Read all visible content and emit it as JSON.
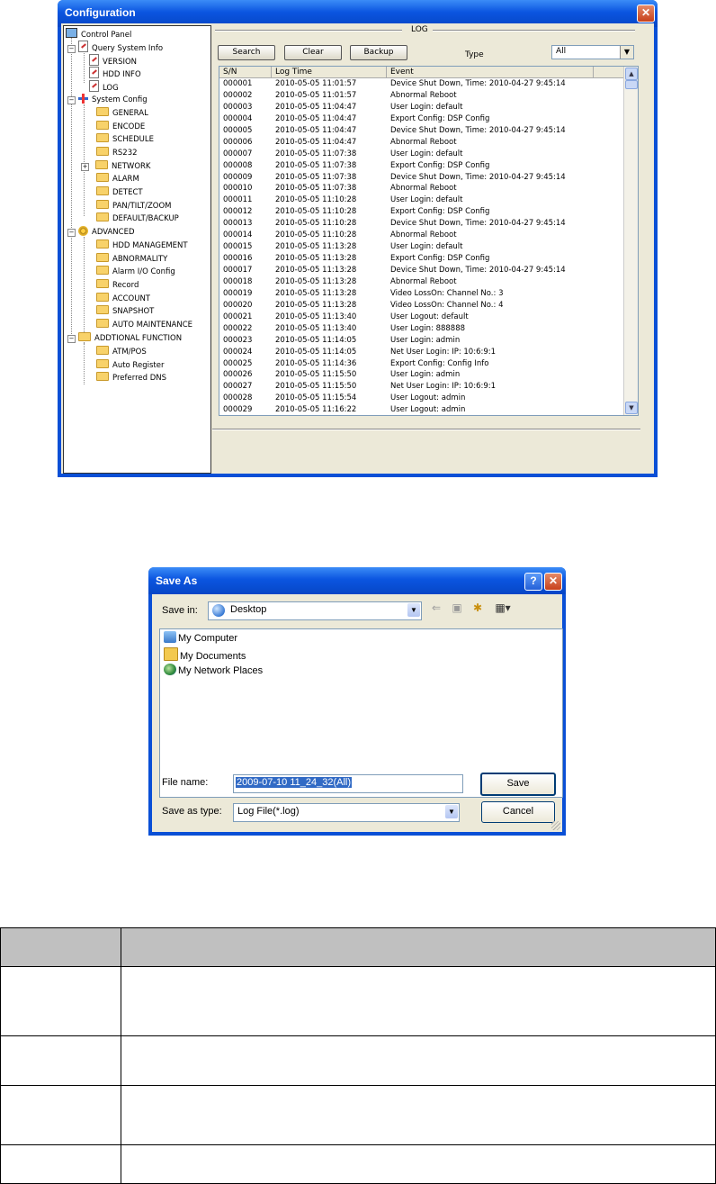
{
  "config_window": {
    "title": "Configuration",
    "close_glyph": "✕",
    "tree": {
      "root": "Control Panel",
      "query_system_info": "Query System Info",
      "version": "VERSION",
      "hdd_info": "HDD INFO",
      "log": "LOG",
      "system_config": "System Config",
      "general": "GENERAL",
      "encode": "ENCODE",
      "schedule": "SCHEDULE",
      "rs232": "RS232",
      "network": "NETWORK",
      "alarm": "ALARM",
      "detect": "DETECT",
      "pan_tilt_zoom": "PAN/TILT/ZOOM",
      "default_backup": "DEFAULT/BACKUP",
      "advanced": "ADVANCED",
      "hdd_management": "HDD MANAGEMENT",
      "abnormality": "ABNORMALITY",
      "alarm_io_config": "Alarm I/O Config",
      "record": "Record",
      "account": "ACCOUNT",
      "snapshot": "SNAPSHOT",
      "auto_maintenance": "AUTO MAINTENANCE",
      "additional_function": "ADDTIONAL FUNCTION",
      "atm_pos": "ATM/POS",
      "auto_register": "Auto Register",
      "preferred_dns": "Preferred DNS",
      "collapse_glyph": "−",
      "expand_glyph": "+"
    },
    "log_panel": {
      "group_title": "LOG",
      "search_label": "Search",
      "clear_label": "Clear",
      "backup_label": "Backup",
      "type_label": "Type",
      "type_value": "All",
      "dropdown_glyph": "▼",
      "columns": {
        "sn": "S/N",
        "time": "Log Time",
        "event": "Event"
      },
      "scroll_up_glyph": "▲",
      "scroll_down_glyph": "▼",
      "rows": [
        {
          "sn": "000001",
          "time": "2010-05-05 11:01:57",
          "event": "Device Shut Down, Time: 2010-04-27 9:45:14"
        },
        {
          "sn": "000002",
          "time": "2010-05-05 11:01:57",
          "event": "Abnormal Reboot"
        },
        {
          "sn": "000003",
          "time": "2010-05-05 11:04:47",
          "event": "User Login: default"
        },
        {
          "sn": "000004",
          "time": "2010-05-05 11:04:47",
          "event": "Export Config: DSP Config"
        },
        {
          "sn": "000005",
          "time": "2010-05-05 11:04:47",
          "event": "Device Shut Down, Time: 2010-04-27 9:45:14"
        },
        {
          "sn": "000006",
          "time": "2010-05-05 11:04:47",
          "event": "Abnormal Reboot"
        },
        {
          "sn": "000007",
          "time": "2010-05-05 11:07:38",
          "event": "User Login: default"
        },
        {
          "sn": "000008",
          "time": "2010-05-05 11:07:38",
          "event": "Export Config: DSP Config"
        },
        {
          "sn": "000009",
          "time": "2010-05-05 11:07:38",
          "event": "Device Shut Down, Time: 2010-04-27 9:45:14"
        },
        {
          "sn": "000010",
          "time": "2010-05-05 11:07:38",
          "event": "Abnormal Reboot"
        },
        {
          "sn": "000011",
          "time": "2010-05-05 11:10:28",
          "event": "User Login: default"
        },
        {
          "sn": "000012",
          "time": "2010-05-05 11:10:28",
          "event": "Export Config: DSP Config"
        },
        {
          "sn": "000013",
          "time": "2010-05-05 11:10:28",
          "event": "Device Shut Down, Time: 2010-04-27 9:45:14"
        },
        {
          "sn": "000014",
          "time": "2010-05-05 11:10:28",
          "event": "Abnormal Reboot"
        },
        {
          "sn": "000015",
          "time": "2010-05-05 11:13:28",
          "event": "User Login: default"
        },
        {
          "sn": "000016",
          "time": "2010-05-05 11:13:28",
          "event": "Export Config: DSP Config"
        },
        {
          "sn": "000017",
          "time": "2010-05-05 11:13:28",
          "event": "Device Shut Down, Time: 2010-04-27 9:45:14"
        },
        {
          "sn": "000018",
          "time": "2010-05-05 11:13:28",
          "event": "Abnormal Reboot"
        },
        {
          "sn": "000019",
          "time": "2010-05-05 11:13:28",
          "event": "Video LossOn: Channel No.: 3"
        },
        {
          "sn": "000020",
          "time": "2010-05-05 11:13:28",
          "event": "Video LossOn: Channel No.: 4"
        },
        {
          "sn": "000021",
          "time": "2010-05-05 11:13:40",
          "event": "User Logout: default"
        },
        {
          "sn": "000022",
          "time": "2010-05-05 11:13:40",
          "event": "User Login: 888888"
        },
        {
          "sn": "000023",
          "time": "2010-05-05 11:14:05",
          "event": "User Login: admin"
        },
        {
          "sn": "000024",
          "time": "2010-05-05 11:14:05",
          "event": "Net User Login: IP: 10:6:9:1"
        },
        {
          "sn": "000025",
          "time": "2010-05-05 11:14:36",
          "event": "Export Config: Config Info"
        },
        {
          "sn": "000026",
          "time": "2010-05-05 11:15:50",
          "event": "User Login: admin"
        },
        {
          "sn": "000027",
          "time": "2010-05-05 11:15:50",
          "event": "Net User Login: IP: 10:6:9:1"
        },
        {
          "sn": "000028",
          "time": "2010-05-05 11:15:54",
          "event": "User Logout: admin"
        },
        {
          "sn": "000029",
          "time": "2010-05-05 11:16:22",
          "event": "User Logout: admin"
        }
      ]
    }
  },
  "save_as_dialog": {
    "title": "Save As",
    "help_glyph": "?",
    "close_glyph": "✕",
    "save_in_label": "Save in:",
    "save_in_value": "Desktop",
    "dropdown_glyph": "▼",
    "toolbar": {
      "back_glyph": "⇐",
      "up_glyph": "▣",
      "new_folder_glyph": "✱",
      "views_glyph": "▦▾"
    },
    "items": [
      "My Computer",
      "My Documents",
      "My Network Places"
    ],
    "file_name_label": "File name:",
    "file_name_value": "2009-07-10 11_24_32(All)",
    "save_as_type_label": "Save as type:",
    "save_as_type_value": "Log File(*.log)",
    "save_label": "Save",
    "cancel_label": "Cancel"
  }
}
